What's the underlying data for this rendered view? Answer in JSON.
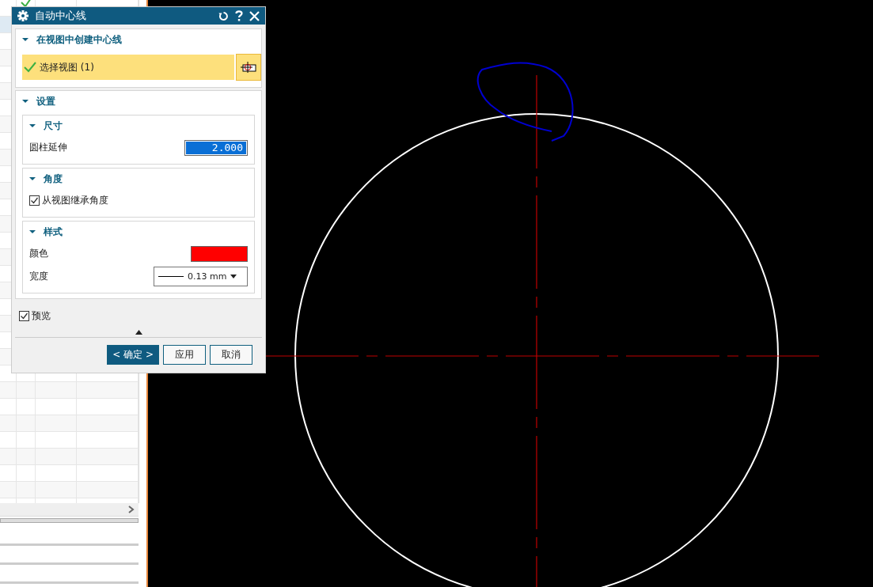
{
  "background_table": {
    "rows": [
      {
        "checked": true,
        "selected": false
      },
      {
        "checked": false,
        "selected": true
      }
    ]
  },
  "dialog": {
    "title": "自动中心线",
    "sections": [
      {
        "kind": "selection",
        "title": "在视图中创建中心线",
        "expanded": true,
        "row": {
          "label": "选择视图 (1)",
          "done": true
        }
      },
      {
        "kind": "group",
        "title": "设置",
        "expanded": true,
        "subsections": [
          {
            "title": "尺寸",
            "expanded": true,
            "items": [
              {
                "kind": "number",
                "label": "圆柱延伸",
                "value": "2.000"
              }
            ]
          },
          {
            "title": "角度",
            "expanded": true,
            "items": [
              {
                "kind": "checkbox",
                "label": "从视图继承角度",
                "checked": true
              }
            ]
          },
          {
            "title": "样式",
            "expanded": true,
            "items": [
              {
                "kind": "color",
                "label": "颜色",
                "color": "#ff0000"
              },
              {
                "kind": "linewidth",
                "label": "宽度",
                "value": "0.13 mm"
              }
            ]
          }
        ]
      }
    ],
    "preview": {
      "label": "预览",
      "checked": true
    },
    "buttons": [
      {
        "kind": "primary",
        "label": "< 确定 >"
      },
      {
        "kind": "normal",
        "label": "应用"
      },
      {
        "kind": "normal",
        "label": "取消"
      }
    ]
  }
}
